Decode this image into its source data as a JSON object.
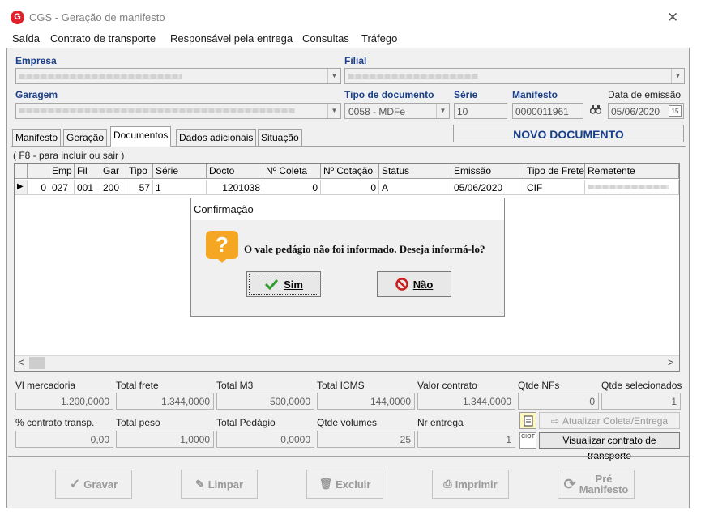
{
  "window": {
    "title": "CGS - Geração de manifesto",
    "close_glyph": "✕",
    "logo_letter": "G",
    "accent": "#e0202a"
  },
  "menu": [
    "Saída",
    "Contrato de transporte",
    "Responsável pela entrega",
    "Consultas",
    "Tráfego"
  ],
  "header": {
    "empresa_label": "Empresa",
    "filial_label": "Filial",
    "garagem_label": "Garagem",
    "tipo_doc_label": "Tipo de documento",
    "tipo_doc_value": "0058 - MDFe",
    "serie_label": "Série",
    "serie_value": "10",
    "manifesto_label": "Manifesto",
    "manifesto_value": "0000011961",
    "data_label": "Data de emissão",
    "data_value": "05/06/2020",
    "calendar_glyph": "15",
    "binoculars_glyph": "⛶"
  },
  "tabs": [
    "Manifesto",
    "Geração",
    "Documentos",
    "Dados adicionais",
    "Situação"
  ],
  "status_banner": "NOVO DOCUMENTO",
  "hint": "( F8 - para incluir ou sair )",
  "grid": {
    "columns": [
      "",
      "Emp",
      "Fil",
      "Gar",
      "Tipo",
      "Série",
      "Docto",
      "Nº Coleta",
      "Nº Cotação",
      "Status",
      "Emissão",
      "Tipo de Frete",
      "Remetente"
    ],
    "row": [
      "0",
      "027",
      "001",
      "200",
      "57",
      "1",
      "1201038",
      "0",
      "0",
      "A",
      "05/06/2020",
      "CIF"
    ],
    "row_pointer": "▶",
    "scroll_left": "<",
    "scroll_right": ">"
  },
  "dialog": {
    "title": "Confirmação",
    "message": "O vale pedágio não foi informado. Deseja informá-lo?",
    "yes": "Sim",
    "no": "Não",
    "question_glyph": "?"
  },
  "stats": {
    "row1": [
      {
        "label": "Vl mercadoria",
        "value": "1.200,0000"
      },
      {
        "label": "Total frete",
        "value": "1.344,0000"
      },
      {
        "label": "Total M3",
        "value": "500,0000"
      },
      {
        "label": "Total ICMS",
        "value": "144,0000"
      },
      {
        "label": "Valor contrato",
        "value": "1.344,0000"
      },
      {
        "label": "Qtde NFs",
        "value": "0"
      },
      {
        "label": "Qtde selecionados",
        "value": "1"
      }
    ],
    "row2": [
      {
        "label": "% contrato transp.",
        "value": "0,00"
      },
      {
        "label": "Total peso",
        "value": "1,0000"
      },
      {
        "label": "Total Pedágio",
        "value": "0,0000"
      },
      {
        "label": "Qtde volumes",
        "value": "25"
      },
      {
        "label": "Nr entrega",
        "value": "1"
      }
    ],
    "atualizar": "Atualizar Coleta/Entrega",
    "visualizar": "Visualizar contrato de transporte",
    "ciot": "CIOT"
  },
  "buttons": {
    "gravar": "Gravar",
    "limpar": "Limpar",
    "excluir": "Excluir",
    "imprimir": "Imprimir",
    "pre_manifesto_1": "Pré",
    "pre_manifesto_2": "Manifesto"
  }
}
